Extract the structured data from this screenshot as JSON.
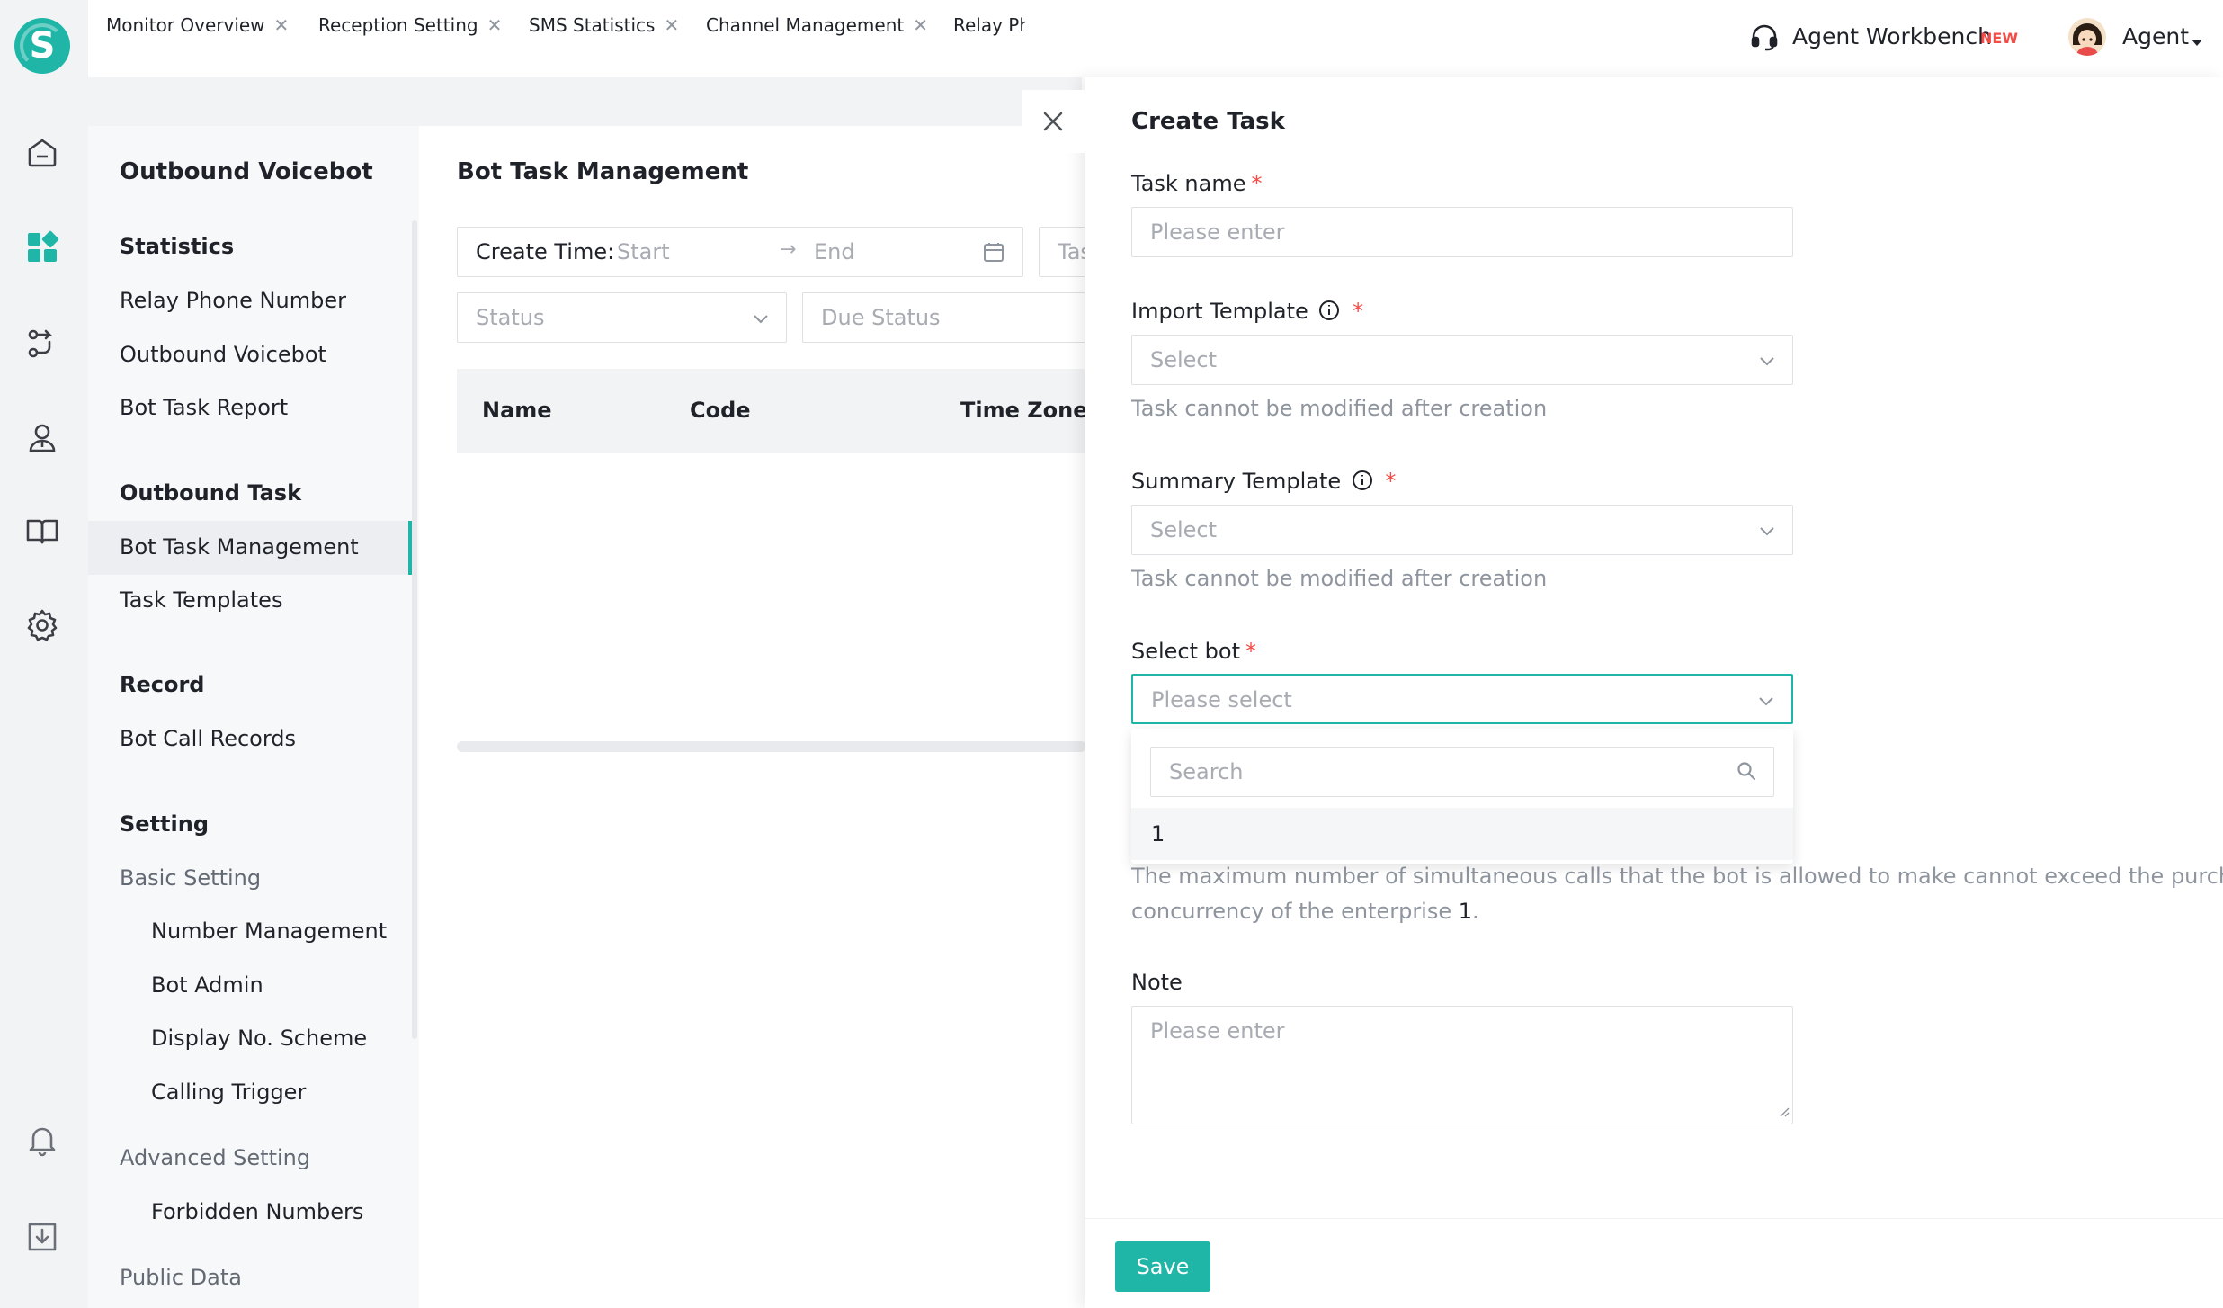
{
  "header": {
    "workbench_label": "Agent Workbench",
    "new_badge": "NEW",
    "user_label": "Agent"
  },
  "tabs": [
    {
      "label": "Monitor Overview"
    },
    {
      "label": "Reception Setting"
    },
    {
      "label": "SMS Statistics"
    },
    {
      "label": "Channel Management"
    },
    {
      "label": "Relay Ph"
    }
  ],
  "menu": {
    "title": "Outbound Voicebot",
    "groups": {
      "statistics": "Statistics",
      "outbound_task": "Outbound Task",
      "record": "Record",
      "setting": "Setting",
      "public_data": "Public Data"
    },
    "items": {
      "relay_phone_number": "Relay Phone Number",
      "outbound_voicebot": "Outbound Voicebot",
      "bot_task_report": "Bot Task Report",
      "bot_task_management": "Bot Task Management",
      "task_templates": "Task Templates",
      "bot_call_records": "Bot Call Records",
      "basic_setting": "Basic Setting",
      "number_management": "Number Management",
      "bot_admin": "Bot Admin",
      "display_no_scheme": "Display No. Scheme",
      "calling_trigger": "Calling Trigger",
      "advanced_setting": "Advanced Setting",
      "forbidden_numbers": "Forbidden Numbers"
    }
  },
  "main": {
    "page_title": "Bot Task Management",
    "filters": {
      "create_time_label": "Create Time:",
      "start_placeholder": "Start",
      "end_placeholder": "End",
      "task_placeholder": "Tas",
      "status_placeholder": "Status",
      "due_status_placeholder": "Due Status"
    },
    "table": {
      "columns": [
        "Name",
        "Code",
        "Time Zone"
      ]
    }
  },
  "drawer": {
    "title": "Create Task",
    "task_name_label": "Task name",
    "task_name_placeholder": "Please enter",
    "import_template_label": "Import Template",
    "import_template_placeholder": "Select",
    "import_template_hint": "Task cannot be modified after creation",
    "summary_template_label": "Summary Template",
    "summary_template_placeholder": "Select",
    "summary_template_hint": "Task cannot be modified after creation",
    "select_bot_label": "Select bot",
    "select_bot_placeholder": "Please select",
    "dropdown_search_placeholder": "Search",
    "dropdown_options": [
      "1"
    ],
    "concurrency_hint_line1": "The maximum number of simultaneous calls that the bot is allowed to make cannot exceed the purchased",
    "concurrency_hint_line2_prefix": "concurrency of the enterprise",
    "concurrency_value": "1",
    "concurrency_hint_suffix": ".",
    "note_label": "Note",
    "note_placeholder": "Please enter",
    "save_label": "Save",
    "required_mark": "*"
  },
  "colors": {
    "accent": "#1fb6a8",
    "required": "#f54a45",
    "new_badge": "#f54a45"
  }
}
